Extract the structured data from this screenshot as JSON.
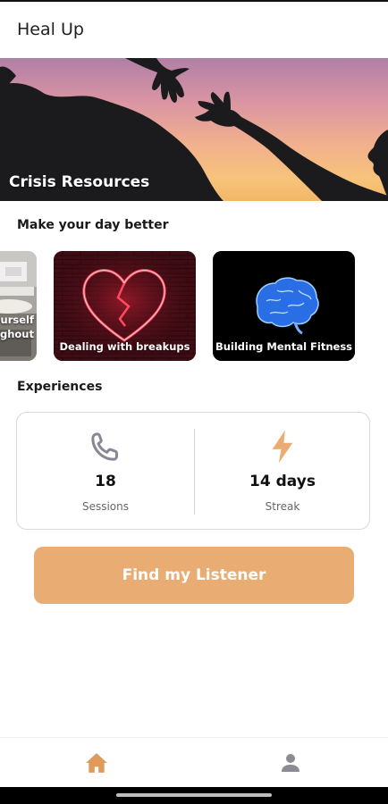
{
  "app": {
    "title": "Heal Up"
  },
  "hero": {
    "title": "Crisis Resources"
  },
  "sections": {
    "make_day_better": "Make your day better",
    "experiences": "Experiences"
  },
  "cards": [
    {
      "line1": "ourself",
      "line2": "ghout",
      "icon": "person-photo"
    },
    {
      "label": "Dealing with breakups",
      "icon": "broken-heart-icon"
    },
    {
      "label": "Building Mental Fitness",
      "icon": "brain-icon"
    }
  ],
  "stats": [
    {
      "value": "18",
      "label": "Sessions",
      "icon": "phone-icon"
    },
    {
      "value": "14 days",
      "label": "Streak",
      "icon": "lightning-icon"
    }
  ],
  "cta": {
    "label": "Find my Listener"
  },
  "nav": {
    "items": [
      {
        "name": "home",
        "icon": "home-icon",
        "active": true
      },
      {
        "name": "profile",
        "icon": "person-icon",
        "active": false
      }
    ]
  },
  "colors": {
    "accent": "#e9ac72",
    "nav_active": "#e09a5a",
    "nav_inactive": "#8e8a94",
    "phone_icon": "#8a8794",
    "bolt_icon": "#e9ac72"
  }
}
